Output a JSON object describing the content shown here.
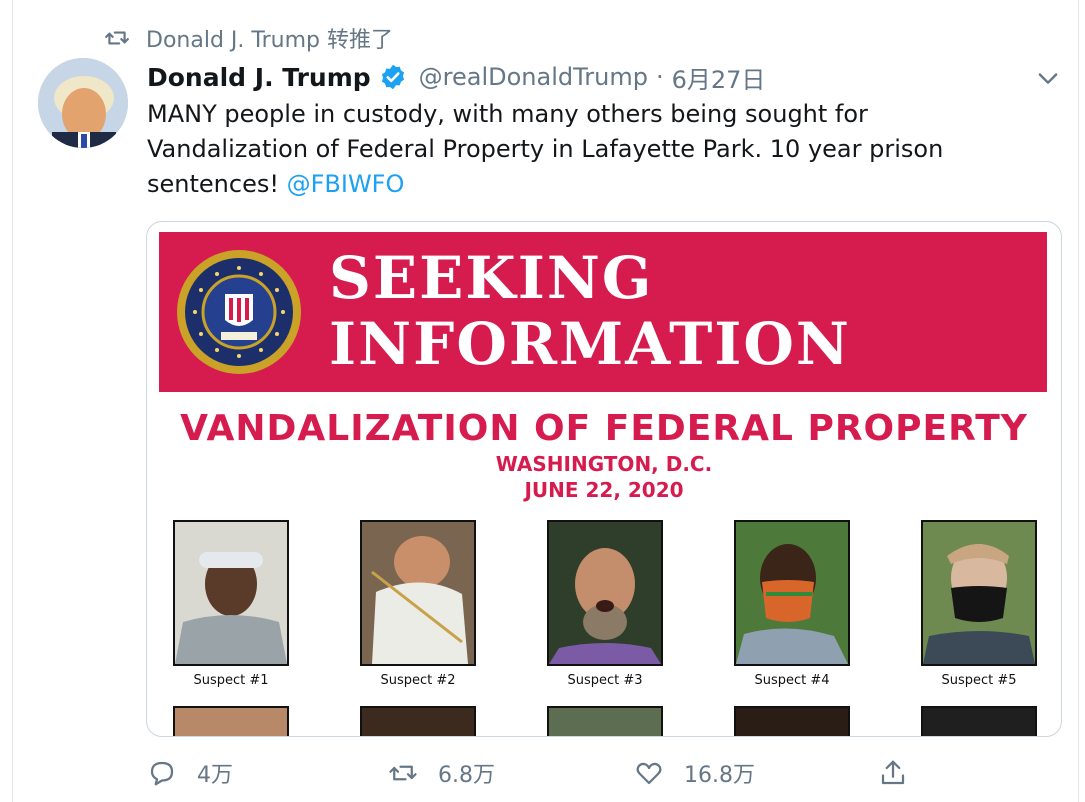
{
  "retweet_context": {
    "icon": "retweet-icon",
    "text": "Donald J. Trump 转推了"
  },
  "author": {
    "name": "Donald J. Trump",
    "handle": "@realDonaldTrump",
    "separator": "·",
    "date": "6月27日",
    "verified": true
  },
  "tweet": {
    "line1": "MANY people in custody, with many others being sought for",
    "line2": "Vandalization of Federal Property in Lafayette Park. 10 year prison",
    "line3_prefix": "sentences! ",
    "mention": "@FBIWFO"
  },
  "poster": {
    "banner_line1": "SEEKING",
    "banner_line2": "INFORMATION",
    "seal_text": "DEPARTMENT OF JUSTICE • FEDERAL BUREAU OF INVESTIGATION",
    "title": "VANDALIZATION OF FEDERAL PROPERTY",
    "place": "WASHINGTON, D.C.",
    "date": "JUNE 22, 2020",
    "suspects": [
      "Suspect #1",
      "Suspect #2",
      "Suspect #3",
      "Suspect #4",
      "Suspect #5"
    ]
  },
  "actions": {
    "reply_count": "4万",
    "retweet_count": "6.8万",
    "like_count": "16.8万"
  },
  "colors": {
    "accent": "#1da1f2",
    "banner_red": "#d61c4e",
    "muted": "#657786"
  }
}
